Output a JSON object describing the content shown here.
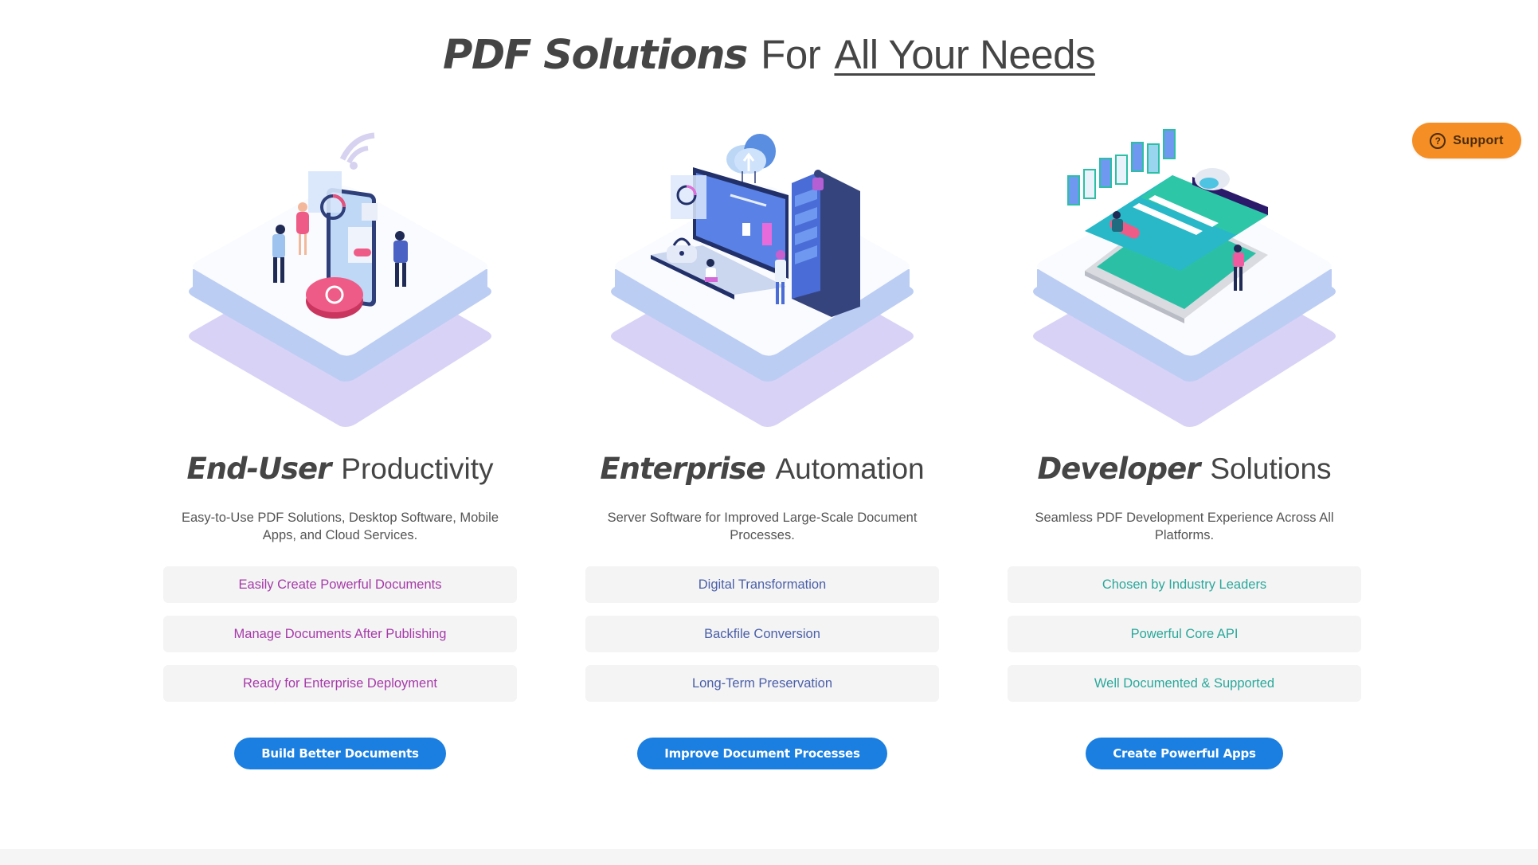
{
  "title": {
    "strong": "PDF Solutions",
    "middle": "For",
    "underlined": "All Your Needs"
  },
  "support": {
    "icon": "question-circle-icon",
    "icon_glyph": "?",
    "label": "Support",
    "color": "#f58e25"
  },
  "columns": [
    {
      "heading_bold": "End-User",
      "heading_light": "Productivity",
      "description": "Easy-to-Use PDF Solutions, Desktop Software, Mobile Apps, and Cloud Services.",
      "illustration": "end-user-productivity-illustration",
      "features": [
        "Easily Create Powerful Documents",
        "Manage Documents After Publishing",
        "Ready for Enterprise Deployment"
      ],
      "feature_color": "#a63aa8",
      "cta": "Build Better Documents"
    },
    {
      "heading_bold": "Enterprise",
      "heading_light": "Automation",
      "description": "Server Software for Improved Large-Scale Document Processes.",
      "illustration": "enterprise-automation-illustration",
      "features": [
        "Digital Transformation",
        "Backfile Conversion",
        "Long-Term Preservation"
      ],
      "feature_color": "#4a5fa8",
      "cta": "Improve Document Processes"
    },
    {
      "heading_bold": "Developer",
      "heading_light": "Solutions",
      "description": "Seamless PDF Development Experience Across All Platforms.",
      "illustration": "developer-solutions-illustration",
      "features": [
        "Chosen by Industry Leaders",
        "Powerful Core API",
        "Well Documented & Supported"
      ],
      "feature_color": "#2aa89a",
      "cta": "Create Powerful Apps"
    }
  ],
  "colors": {
    "cta": "#1a7fe0",
    "feature_bg": "#f4f4f5",
    "heading": "#454545"
  }
}
